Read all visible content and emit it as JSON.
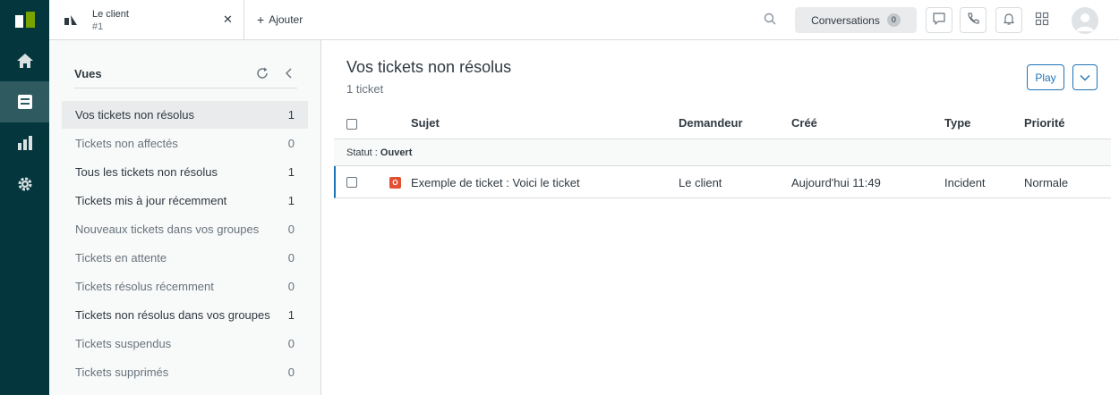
{
  "tab": {
    "title": "Le client",
    "subtitle": "#1",
    "close_glyph": "✕"
  },
  "add_tab": {
    "plus": "+",
    "label": "Ajouter"
  },
  "conversations": {
    "label": "Conversations",
    "count": "0"
  },
  "icons": {
    "rail": [
      "zendesk-logo-icon",
      "home-icon",
      "views-icon",
      "reporting-icon",
      "admin-gear-icon"
    ],
    "topbar": [
      "search-icon",
      "chat-icon",
      "phone-icon",
      "bell-icon",
      "apps-grid-icon",
      "avatar"
    ]
  },
  "colors": {
    "rail": "#03363d",
    "accent": "#1f73b7",
    "open_status": "#e34f32"
  },
  "views_panel": {
    "title": "Vues",
    "items": [
      {
        "label": "Vos tickets non résolus",
        "count": "1"
      },
      {
        "label": "Tickets non affectés",
        "count": "0"
      },
      {
        "label": "Tous les tickets non résolus",
        "count": "1"
      },
      {
        "label": "Tickets mis à jour récemment",
        "count": "1"
      },
      {
        "label": "Nouveaux tickets dans vos groupes",
        "count": "0"
      },
      {
        "label": "Tickets en attente",
        "count": "0"
      },
      {
        "label": "Tickets résolus récemment",
        "count": "0"
      },
      {
        "label": "Tickets non résolus dans vos groupes",
        "count": "1"
      },
      {
        "label": "Tickets suspendus",
        "count": "0"
      },
      {
        "label": "Tickets supprimés",
        "count": "0"
      }
    ]
  },
  "main": {
    "title": "Vos tickets non résolus",
    "subtitle": "1 ticket",
    "play_label": "Play",
    "columns": [
      "Sujet",
      "Demandeur",
      "Créé",
      "Type",
      "Priorité"
    ],
    "group": {
      "label": "Statut : ",
      "value": "Ouvert"
    },
    "rows": [
      {
        "status": "O",
        "subject": "Exemple de ticket : Voici le ticket",
        "requester": "Le client",
        "created": "Aujourd'hui 11:49",
        "type": "Incident",
        "priority": "Normale"
      }
    ]
  }
}
